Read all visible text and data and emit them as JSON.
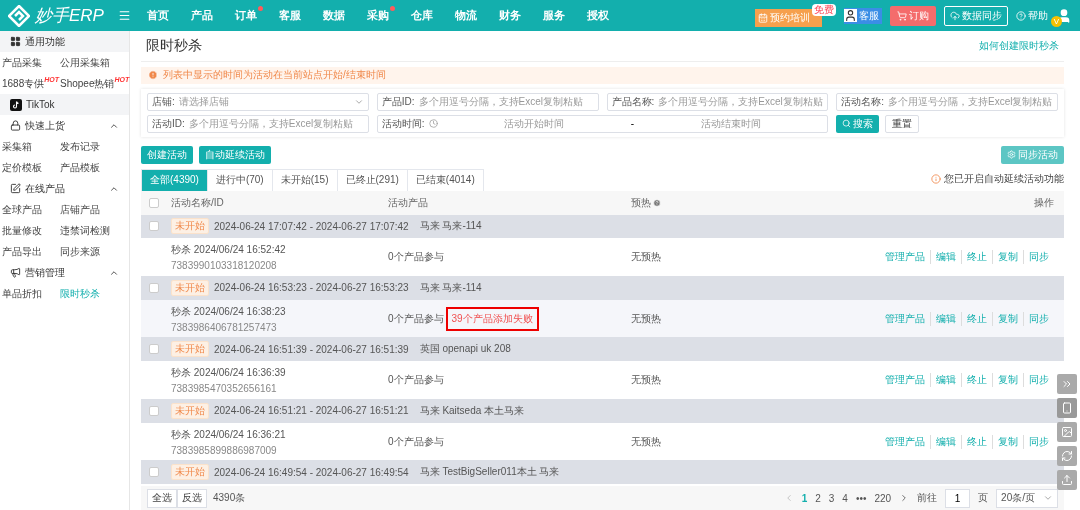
{
  "brand": {
    "name": "妙手ERP"
  },
  "nav": [
    {
      "label": "首页",
      "dot": false
    },
    {
      "label": "产品",
      "dot": false
    },
    {
      "label": "订单",
      "dot": true
    },
    {
      "label": "客服",
      "dot": false
    },
    {
      "label": "数据",
      "dot": false
    },
    {
      "label": "采购",
      "dot": true
    },
    {
      "label": "仓库",
      "dot": false
    },
    {
      "label": "物流",
      "dot": false
    },
    {
      "label": "财务",
      "dot": false
    },
    {
      "label": "服务",
      "dot": false
    },
    {
      "label": "授权",
      "dot": false
    }
  ],
  "header_actions": {
    "training": "预约培训",
    "training_badge": "免费",
    "service": "客服",
    "order": "订购",
    "sync": "数据同步",
    "help": "帮助",
    "avatar_badge": "V"
  },
  "sidebar": [
    {
      "title": "通用功能",
      "kind": "plain",
      "items": [
        {
          "label": "产品采集",
          "selected": false
        },
        {
          "label": "公用采集箱",
          "selected": false
        },
        {
          "label": "1688专供",
          "badge": "HOT",
          "selected": false
        },
        {
          "label": "Shopee热销",
          "badge": "HOT",
          "selected": false
        }
      ]
    },
    {
      "title": "TikTok",
      "kind": "platform"
    },
    {
      "title": "快速上货",
      "kind": "collapsible",
      "items": [
        {
          "label": "采集箱",
          "selected": false
        },
        {
          "label": "发布记录",
          "selected": false
        },
        {
          "label": "定价模板",
          "selected": false
        },
        {
          "label": "产品模板",
          "selected": false
        }
      ]
    },
    {
      "title": "在线产品",
      "kind": "collapsible",
      "items": [
        {
          "label": "全球产品",
          "selected": false
        },
        {
          "label": "店铺产品",
          "selected": false
        },
        {
          "label": "批量修改",
          "selected": false
        },
        {
          "label": "违禁词检测",
          "selected": false
        },
        {
          "label": "产品导出",
          "selected": false
        },
        {
          "label": "同步来源",
          "selected": false
        }
      ]
    },
    {
      "title": "营销管理",
      "kind": "collapsible",
      "items": [
        {
          "label": "单品折扣",
          "selected": false
        },
        {
          "label": "限时秒杀",
          "selected": true
        }
      ]
    }
  ],
  "page": {
    "title": "限时秒杀",
    "help_link": "如何创建限时秒杀",
    "notice": "列表中显示的时间为活动在当前站点开始/结束时间"
  },
  "filters": [
    {
      "kind": "select",
      "label": "店铺:",
      "placeholder": "请选择店铺"
    },
    {
      "kind": "text",
      "label": "产品ID:",
      "placeholder": "多个用逗号分隔，支持Excel复制粘贴"
    },
    {
      "kind": "text",
      "label": "产品名称:",
      "placeholder": "多个用逗号分隔，支持Excel复制粘贴"
    },
    {
      "kind": "text",
      "label": "活动名称:",
      "placeholder": "多个用逗号分隔，支持Excel复制粘贴"
    },
    {
      "kind": "text",
      "label": "活动ID:",
      "placeholder": "多个用逗号分隔，支持Excel复制粘贴"
    },
    {
      "kind": "daterange",
      "label": "活动时间:",
      "placeholder": "活动开始时间",
      "end_placeholder": "活动结束时间",
      "separator": "-"
    }
  ],
  "search_button": "搜索",
  "reset_button": "重置",
  "action_buttons": [
    "创建活动",
    "自动延续活动"
  ],
  "sync_button": "同步活动",
  "tabs": [
    {
      "label": "全部(4390)",
      "selected": true
    },
    {
      "label": "进行中(70)",
      "selected": false
    },
    {
      "label": "未开始(15)",
      "selected": false
    },
    {
      "label": "已终止(291)",
      "selected": false
    },
    {
      "label": "已结束(4014)",
      "selected": false
    }
  ],
  "auto_notice": "您已开启自动延续活动功能",
  "table": {
    "header_checked": false,
    "columns": [
      "活动名称/ID",
      "活动产品",
      "预热",
      "操作"
    ],
    "rows": [
      {
        "checked": false,
        "status": "未开始",
        "period": "2024-06-24 17:07:42 - 2024-06-27 17:07:42",
        "shop": "马来 马来-114",
        "name": "秒杀 2024/06/24 16:52:42",
        "id": "7383990103318120208",
        "products": "0个产品参与",
        "preheat": "无预热",
        "actions": [
          "管理产品",
          "编辑",
          "终止",
          "复制",
          "同步"
        ]
      },
      {
        "checked": false,
        "status": "未开始",
        "period": "2024-06-24 16:53:23 - 2024-06-27 16:53:23",
        "shop": "马来 马来-114",
        "name": "秒杀 2024/06/24 16:38:23",
        "id": "7383986406781257473",
        "products": "0个产品参与",
        "failure": "39个产品添加失败",
        "preheat": "无预热",
        "actions": [
          "管理产品",
          "编辑",
          "终止",
          "复制",
          "同步"
        ]
      },
      {
        "checked": false,
        "status": "未开始",
        "period": "2024-06-24 16:51:39 - 2024-06-27 16:51:39",
        "shop": "英国 openapi uk 208",
        "name": "秒杀 2024/06/24 16:36:39",
        "id": "7383985470352656161",
        "products": "0个产品参与",
        "preheat": "无预热",
        "actions": [
          "管理产品",
          "编辑",
          "终止",
          "复制",
          "同步"
        ]
      },
      {
        "checked": false,
        "status": "未开始",
        "period": "2024-06-24 16:51:21 - 2024-06-27 16:51:21",
        "shop": "马来 Kaitseda 本土马来",
        "name": "秒杀 2024/06/24 16:36:21",
        "id": "7383985899886987009",
        "products": "0个产品参与",
        "preheat": "无预热",
        "actions": [
          "管理产品",
          "编辑",
          "终止",
          "复制",
          "同步"
        ]
      },
      {
        "checked": false,
        "status": "未开始",
        "period": "2024-06-24 16:49:54 - 2024-06-27 16:49:54",
        "shop": "马来 TestBigSeller011本土 马来"
      }
    ]
  },
  "footer": {
    "select_all": "全选",
    "invert": "反选",
    "total": "4390条",
    "pages": [
      {
        "label": "1",
        "selected": true
      },
      {
        "label": "2",
        "selected": false
      },
      {
        "label": "3",
        "selected": false
      },
      {
        "label": "4",
        "selected": false
      }
    ],
    "ellipsis": "•••",
    "last_page": "220",
    "goto": "前往",
    "page_value": "1",
    "page_unit": "页",
    "page_size": "20条/页"
  }
}
